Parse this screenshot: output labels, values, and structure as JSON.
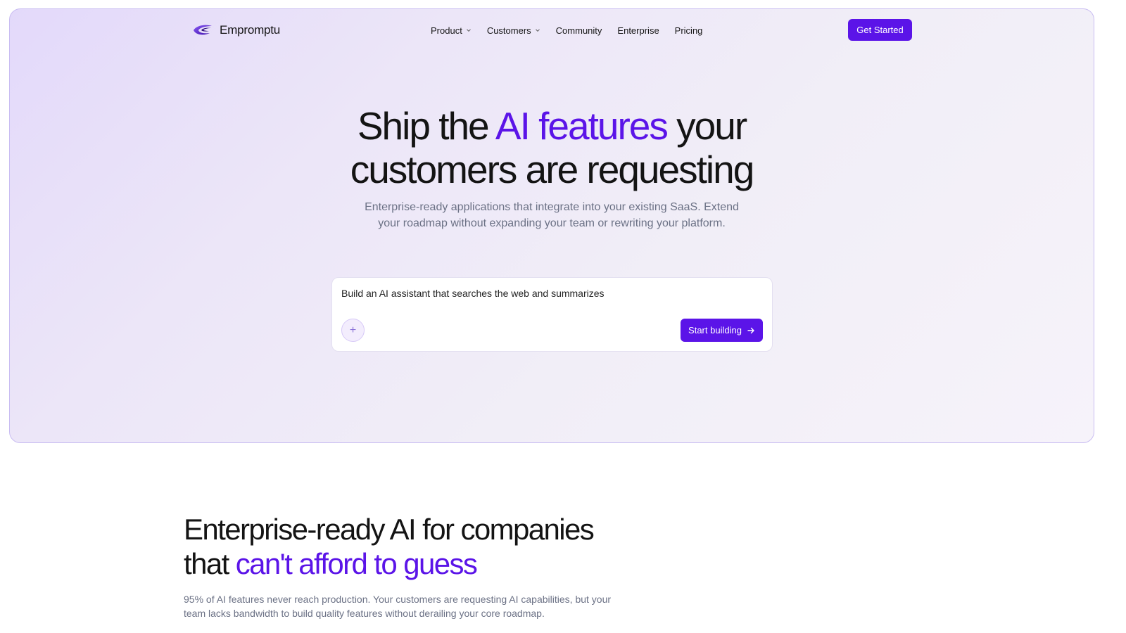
{
  "brand": {
    "name": "Empromptu",
    "accent_color": "#5b14e8"
  },
  "nav": {
    "items": [
      {
        "label": "Product",
        "has_dropdown": true
      },
      {
        "label": "Customers",
        "has_dropdown": true
      },
      {
        "label": "Community",
        "has_dropdown": false
      },
      {
        "label": "Enterprise",
        "has_dropdown": false
      },
      {
        "label": "Pricing",
        "has_dropdown": false
      }
    ],
    "cta_label": "Get Started"
  },
  "hero": {
    "title_part1": "Ship the ",
    "title_accent": "AI features",
    "title_part2": " your",
    "title_line2": "customers are requesting",
    "subtitle_line1": "Enterprise-ready applications that integrate into your existing SaaS. Extend",
    "subtitle_line2": "your roadmap without expanding your team or rewriting your platform."
  },
  "prompt": {
    "value": "Build an AI assistant that searches the web and summarizes",
    "attach_icon": "plus-icon",
    "attach_glyph": "+",
    "submit_label": "Start building",
    "submit_icon": "arrow-right-icon"
  },
  "section2": {
    "title_line1": "Enterprise-ready AI for companies",
    "title_line2_part1": "that ",
    "title_line2_accent": "can't afford to guess",
    "body_line1": "95% of AI features never reach production. Your customers are requesting AI capabilities, but your",
    "body_line2": "team lacks bandwidth to build quality features without derailing your core roadmap."
  }
}
